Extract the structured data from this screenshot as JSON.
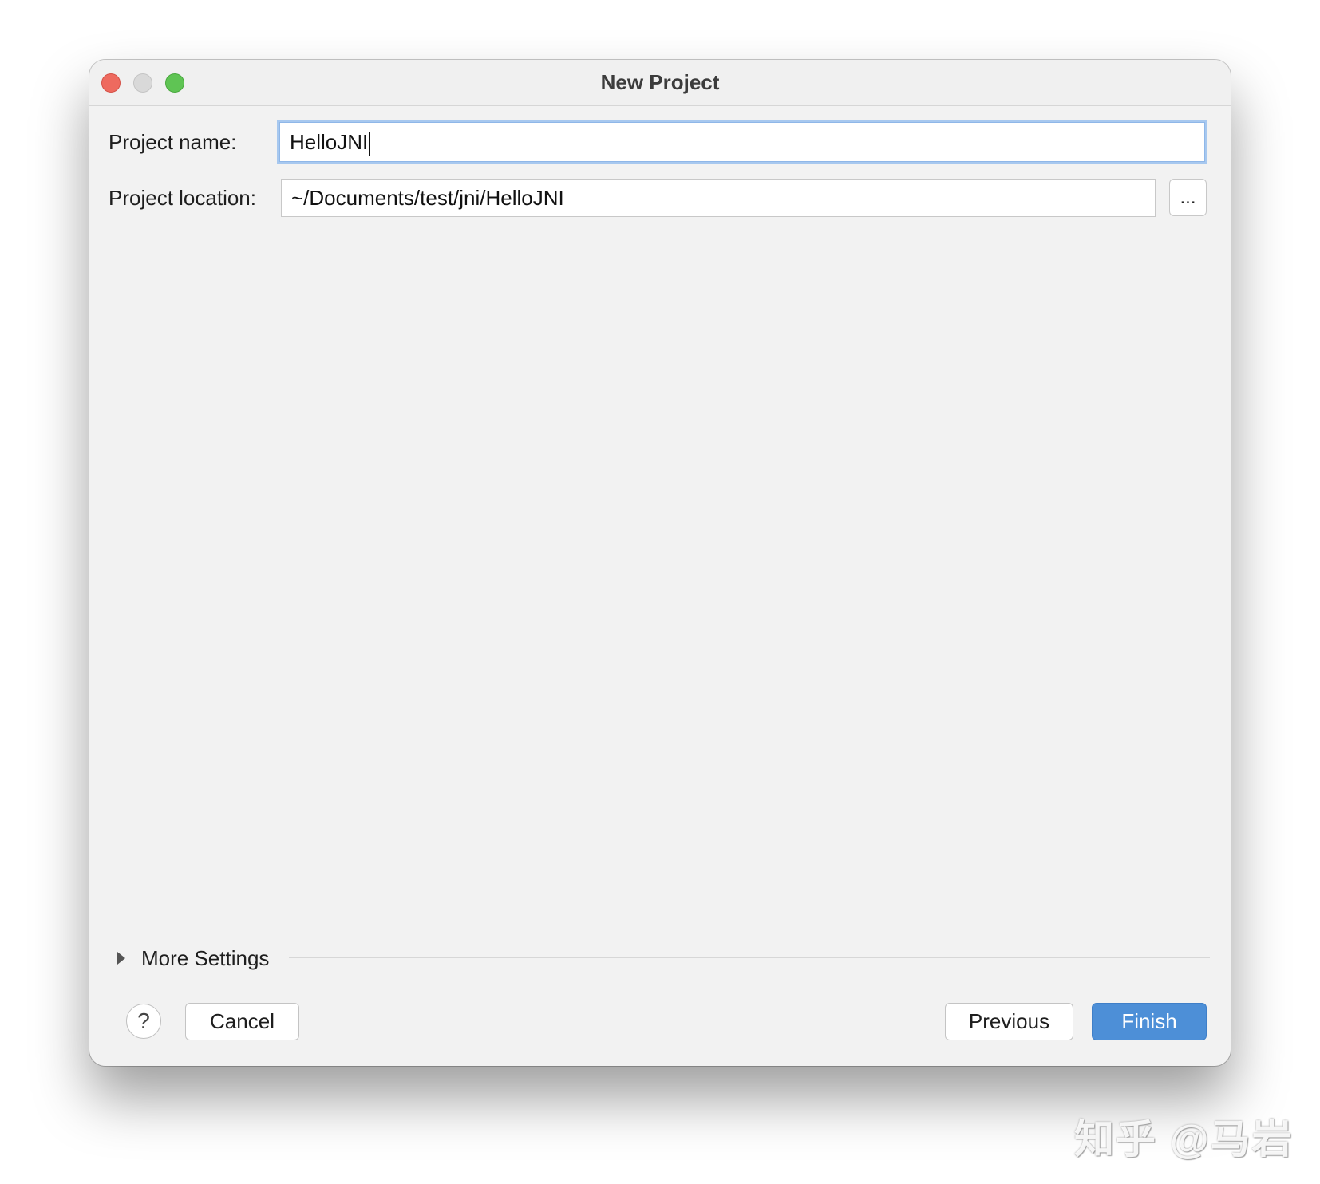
{
  "window": {
    "title": "New Project"
  },
  "form": {
    "project_name_label": "Project name:",
    "project_name_value": "HelloJNI",
    "project_location_label": "Project location:",
    "project_location_value": "~/Documents/test/jni/HelloJNI",
    "browse_label": "..."
  },
  "more_settings": {
    "label": "More Settings"
  },
  "footer": {
    "help_label": "?",
    "cancel_label": "Cancel",
    "previous_label": "Previous",
    "finish_label": "Finish"
  },
  "watermark": {
    "text": "知乎 @马岩"
  },
  "colors": {
    "accent": "#4d8fd7",
    "focus_ring": "#a7c8ef",
    "close": "#ee6a5f",
    "minimize_inactive": "#d9d9d9",
    "maximize": "#5fc454"
  }
}
